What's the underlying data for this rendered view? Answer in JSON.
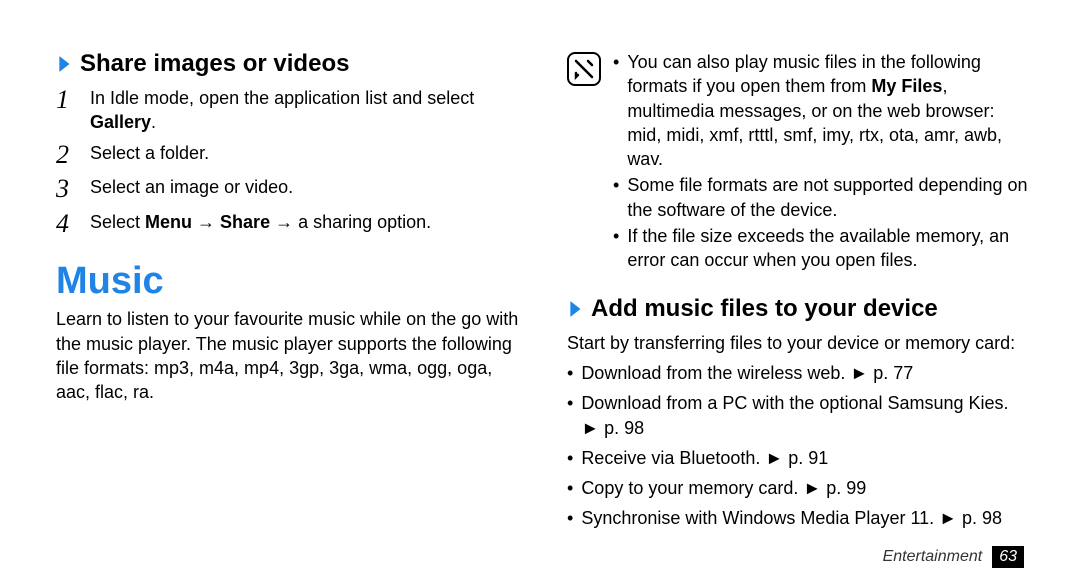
{
  "left": {
    "share_title": "Share images or videos",
    "steps": [
      {
        "n": "1",
        "pre": "In Idle mode, open the application list and select ",
        "bold": "Gallery",
        "post": "."
      },
      {
        "n": "2",
        "pre": "Select a folder.",
        "bold": "",
        "post": ""
      },
      {
        "n": "3",
        "pre": "Select an image or video.",
        "bold": "",
        "post": ""
      },
      {
        "n": "4",
        "pre": "Select ",
        "bold": "Menu",
        "mid": " → ",
        "bold2": "Share",
        "post": " → a sharing option."
      }
    ],
    "music_title": "Music",
    "music_body": "Learn to listen to your favourite music while on the go with the music player. The music player supports the following file formats: mp3, m4a, mp4, 3gp, 3ga, wma, ogg, oga, aac, flac, ra."
  },
  "right": {
    "notes": [
      {
        "pre": "You can also play music files in the following formats if you open them from ",
        "bold": "My Files",
        "post": ", multimedia messages, or on the web browser: mid, midi, xmf, rtttl, smf, imy, rtx, ota, amr, awb, wav."
      },
      {
        "pre": "Some file formats are not supported depending on the software of the device.",
        "bold": "",
        "post": ""
      },
      {
        "pre": "If the file size exceeds the available memory, an error can occur when you open files.",
        "bold": "",
        "post": ""
      }
    ],
    "add_title": "Add music files to your device",
    "add_intro": "Start by transferring files to your device or memory card:",
    "methods": [
      "Download from the wireless web. ► p. 77",
      "Download from a PC with the optional Samsung Kies. ► p. 98",
      "Receive via Bluetooth. ► p. 91",
      "Copy to your memory card. ► p. 99",
      "Synchronise with Windows Media Player 11. ► p. 98"
    ]
  },
  "footer": {
    "section": "Entertainment",
    "page": "63"
  }
}
